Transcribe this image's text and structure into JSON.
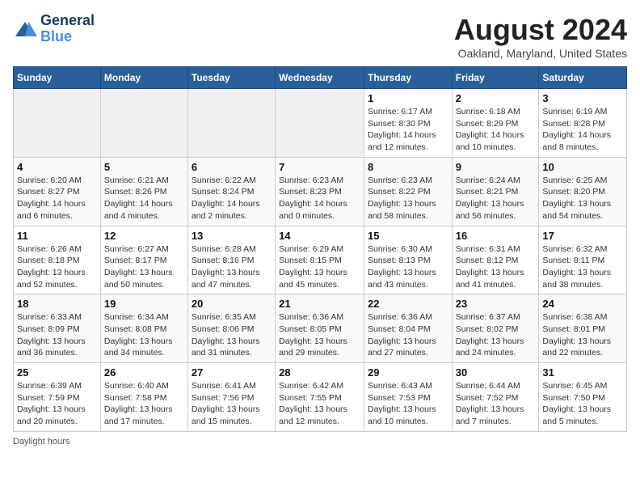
{
  "logo": {
    "line1": "General",
    "line2": "Blue"
  },
  "title": {
    "month_year": "August 2024",
    "location": "Oakland, Maryland, United States"
  },
  "weekdays": [
    "Sunday",
    "Monday",
    "Tuesday",
    "Wednesday",
    "Thursday",
    "Friday",
    "Saturday"
  ],
  "weeks": [
    [
      {
        "day": "",
        "info": ""
      },
      {
        "day": "",
        "info": ""
      },
      {
        "day": "",
        "info": ""
      },
      {
        "day": "",
        "info": ""
      },
      {
        "day": "1",
        "info": "Sunrise: 6:17 AM\nSunset: 8:30 PM\nDaylight: 14 hours and 12 minutes."
      },
      {
        "day": "2",
        "info": "Sunrise: 6:18 AM\nSunset: 8:29 PM\nDaylight: 14 hours and 10 minutes."
      },
      {
        "day": "3",
        "info": "Sunrise: 6:19 AM\nSunset: 8:28 PM\nDaylight: 14 hours and 8 minutes."
      }
    ],
    [
      {
        "day": "4",
        "info": "Sunrise: 6:20 AM\nSunset: 8:27 PM\nDaylight: 14 hours and 6 minutes."
      },
      {
        "day": "5",
        "info": "Sunrise: 6:21 AM\nSunset: 8:26 PM\nDaylight: 14 hours and 4 minutes."
      },
      {
        "day": "6",
        "info": "Sunrise: 6:22 AM\nSunset: 8:24 PM\nDaylight: 14 hours and 2 minutes."
      },
      {
        "day": "7",
        "info": "Sunrise: 6:23 AM\nSunset: 8:23 PM\nDaylight: 14 hours and 0 minutes."
      },
      {
        "day": "8",
        "info": "Sunrise: 6:23 AM\nSunset: 8:22 PM\nDaylight: 13 hours and 58 minutes."
      },
      {
        "day": "9",
        "info": "Sunrise: 6:24 AM\nSunset: 8:21 PM\nDaylight: 13 hours and 56 minutes."
      },
      {
        "day": "10",
        "info": "Sunrise: 6:25 AM\nSunset: 8:20 PM\nDaylight: 13 hours and 54 minutes."
      }
    ],
    [
      {
        "day": "11",
        "info": "Sunrise: 6:26 AM\nSunset: 8:18 PM\nDaylight: 13 hours and 52 minutes."
      },
      {
        "day": "12",
        "info": "Sunrise: 6:27 AM\nSunset: 8:17 PM\nDaylight: 13 hours and 50 minutes."
      },
      {
        "day": "13",
        "info": "Sunrise: 6:28 AM\nSunset: 8:16 PM\nDaylight: 13 hours and 47 minutes."
      },
      {
        "day": "14",
        "info": "Sunrise: 6:29 AM\nSunset: 8:15 PM\nDaylight: 13 hours and 45 minutes."
      },
      {
        "day": "15",
        "info": "Sunrise: 6:30 AM\nSunset: 8:13 PM\nDaylight: 13 hours and 43 minutes."
      },
      {
        "day": "16",
        "info": "Sunrise: 6:31 AM\nSunset: 8:12 PM\nDaylight: 13 hours and 41 minutes."
      },
      {
        "day": "17",
        "info": "Sunrise: 6:32 AM\nSunset: 8:11 PM\nDaylight: 13 hours and 38 minutes."
      }
    ],
    [
      {
        "day": "18",
        "info": "Sunrise: 6:33 AM\nSunset: 8:09 PM\nDaylight: 13 hours and 36 minutes."
      },
      {
        "day": "19",
        "info": "Sunrise: 6:34 AM\nSunset: 8:08 PM\nDaylight: 13 hours and 34 minutes."
      },
      {
        "day": "20",
        "info": "Sunrise: 6:35 AM\nSunset: 8:06 PM\nDaylight: 13 hours and 31 minutes."
      },
      {
        "day": "21",
        "info": "Sunrise: 6:36 AM\nSunset: 8:05 PM\nDaylight: 13 hours and 29 minutes."
      },
      {
        "day": "22",
        "info": "Sunrise: 6:36 AM\nSunset: 8:04 PM\nDaylight: 13 hours and 27 minutes."
      },
      {
        "day": "23",
        "info": "Sunrise: 6:37 AM\nSunset: 8:02 PM\nDaylight: 13 hours and 24 minutes."
      },
      {
        "day": "24",
        "info": "Sunrise: 6:38 AM\nSunset: 8:01 PM\nDaylight: 13 hours and 22 minutes."
      }
    ],
    [
      {
        "day": "25",
        "info": "Sunrise: 6:39 AM\nSunset: 7:59 PM\nDaylight: 13 hours and 20 minutes."
      },
      {
        "day": "26",
        "info": "Sunrise: 6:40 AM\nSunset: 7:58 PM\nDaylight: 13 hours and 17 minutes."
      },
      {
        "day": "27",
        "info": "Sunrise: 6:41 AM\nSunset: 7:56 PM\nDaylight: 13 hours and 15 minutes."
      },
      {
        "day": "28",
        "info": "Sunrise: 6:42 AM\nSunset: 7:55 PM\nDaylight: 13 hours and 12 minutes."
      },
      {
        "day": "29",
        "info": "Sunrise: 6:43 AM\nSunset: 7:53 PM\nDaylight: 13 hours and 10 minutes."
      },
      {
        "day": "30",
        "info": "Sunrise: 6:44 AM\nSunset: 7:52 PM\nDaylight: 13 hours and 7 minutes."
      },
      {
        "day": "31",
        "info": "Sunrise: 6:45 AM\nSunset: 7:50 PM\nDaylight: 13 hours and 5 minutes."
      }
    ]
  ],
  "footer": {
    "note": "Daylight hours"
  }
}
